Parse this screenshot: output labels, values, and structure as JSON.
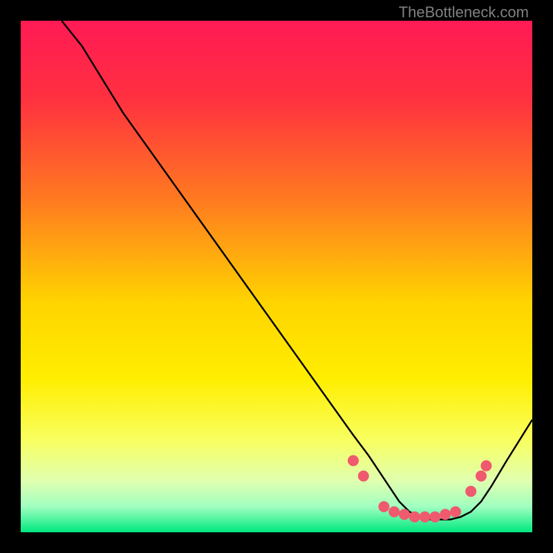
{
  "watermark": "TheBottleneck.com",
  "chart_data": {
    "type": "line",
    "title": "",
    "xlabel": "",
    "ylabel": "",
    "xlim": [
      0,
      100
    ],
    "ylim": [
      0,
      100
    ],
    "gradient": {
      "top": "#ff1744",
      "upper_mid": "#ff9100",
      "mid": "#ffea00",
      "lower_mid": "#eeff41",
      "bottom": "#00e676"
    },
    "series": [
      {
        "name": "bottleneck-curve",
        "x": [
          8,
          12,
          20,
          30,
          40,
          50,
          60,
          65,
          68,
          70,
          72,
          74,
          76,
          78,
          80,
          82,
          84,
          86,
          88,
          90,
          92,
          95,
          100
        ],
        "y": [
          100,
          95,
          82,
          68,
          54,
          40,
          26,
          19,
          15,
          12,
          9,
          6,
          4,
          3,
          2.5,
          2.5,
          2.5,
          3,
          4,
          6,
          9,
          14,
          22
        ]
      }
    ],
    "scatter_points": {
      "name": "data-points",
      "color": "#ef5a6f",
      "x": [
        65,
        67,
        71,
        73,
        75,
        77,
        79,
        81,
        83,
        85,
        88,
        90,
        91
      ],
      "y": [
        14,
        11,
        5,
        4,
        3.5,
        3,
        3,
        3,
        3.5,
        4,
        8,
        11,
        13
      ]
    }
  }
}
